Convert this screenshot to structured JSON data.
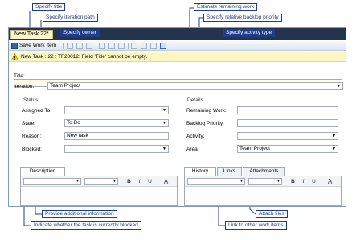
{
  "window": {
    "tab_title": "New Task 22*",
    "close_glyph": "✕"
  },
  "toolbar": {
    "save_label": "Save Work Item"
  },
  "warning": {
    "text": "New Task : 22 : TF20012: Field 'Title' cannot be empty."
  },
  "form": {
    "title_label": "Title:",
    "title_value": "",
    "iteration_label": "Iteration:",
    "iteration_value": "Team Project",
    "status_group": "Status",
    "assigned_to_label": "Assigned To:",
    "assigned_to_value": "",
    "state_label": "State:",
    "state_value": "To Do",
    "reason_label": "Reason:",
    "reason_value": "New task",
    "blocked_label": "Blocked:",
    "blocked_value": "",
    "details_group": "Details",
    "remaining_work_label": "Remaining Work:",
    "remaining_work_value": "",
    "backlog_priority_label": "Backlog Priority:",
    "backlog_priority_value": "",
    "activity_label": "Activity:",
    "activity_value": "",
    "area_label": "Area:",
    "area_value": "Team Project"
  },
  "left_tabs": [
    {
      "label": "Description"
    }
  ],
  "right_tabs": [
    {
      "label": "History"
    },
    {
      "label": "Links"
    },
    {
      "label": "Attachments"
    }
  ],
  "rich_text": {
    "bold": "B",
    "italic": "I",
    "underline": "U",
    "font_color": "A"
  },
  "callouts": {
    "specify_title": "Specify title",
    "specify_iteration": "Specify iteration path",
    "specify_owner": "Specify owner",
    "estimate_remaining": "Estimate remaining work",
    "specify_priority": "Specify relative backlog priority",
    "specify_activity": "Specify activity type",
    "provide_info": "Provide additional information",
    "indicate_blocked": "Indicate whether the task is currently blocked",
    "attach_files": "Attach files",
    "link_items": "Link to other work items"
  },
  "colors": {
    "callout_blue": "#1d3d8a",
    "title_bar": "#25344e",
    "warning_bg": "#fdf6c3"
  },
  "icons": [
    "save-icon",
    "warning-icon",
    "close-icon",
    "dropdown-arrow-icon"
  ]
}
